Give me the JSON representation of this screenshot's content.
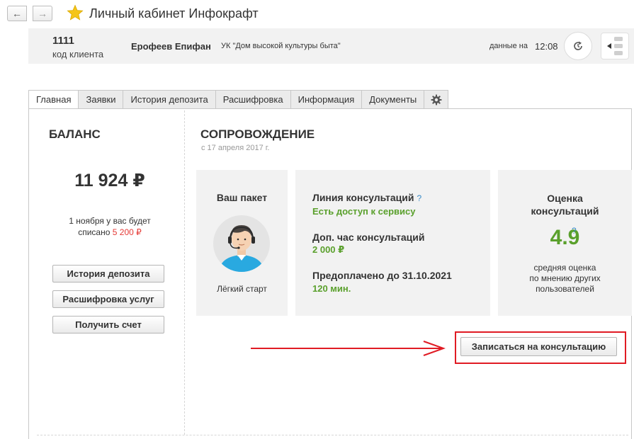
{
  "window": {
    "title": "Личный кабинет Инфокрафт"
  },
  "header": {
    "client_code": "1111",
    "client_code_label": "код клиента",
    "client_name": "Ерофеев Епифан",
    "organization": "УК \"Дом высокой культуры быта\"",
    "data_label": "данные на",
    "data_time": "12:08"
  },
  "tabs": [
    {
      "label": "Главная",
      "active": true
    },
    {
      "label": "Заявки"
    },
    {
      "label": "История депозита"
    },
    {
      "label": "Расшифровка"
    },
    {
      "label": "Информация"
    },
    {
      "label": "Документы"
    }
  ],
  "balance": {
    "title": "БАЛАНС",
    "amount": "11 924 ₽",
    "note_line1": "1 ноября у вас будет",
    "note_line2_prefix": "списано",
    "note_amount": "5 200 ₽",
    "buttons": {
      "history": "История депозита",
      "details": "Расшифровка услуг",
      "invoice": "Получить счет"
    }
  },
  "support": {
    "title": "СОПРОВОЖДЕНИЕ",
    "since": "с 17 апреля 2017 г.",
    "package": {
      "title": "Ваш пакет",
      "name": "Лёгкий старт"
    },
    "consult_line": {
      "label": "Линия консультаций",
      "help": "?",
      "status": "Есть доступ к сервису"
    },
    "extra_hour": {
      "label": "Доп. час консультаций",
      "price": "2 000 ₽"
    },
    "prepaid": {
      "label": "Предоплачено до 31.10.2021",
      "minutes": "120 мин."
    },
    "rating": {
      "title_line1": "Оценка",
      "title_line2": "консультаций",
      "value": "4.9",
      "help": "?",
      "sub_line1": "средняя оценка",
      "sub_line2": "по мнению других",
      "sub_line3": "пользователей"
    },
    "book_button": "Записаться на консультацию"
  },
  "colors": {
    "accent_green": "#5aa02c",
    "accent_red": "#e53935",
    "highlight_red": "#e01b24",
    "help_blue": "#3a8cc8",
    "star_yellow": "#f5c518"
  },
  "icons": {
    "back": "arrow-left-icon",
    "forward": "arrow-right-icon",
    "favorite": "star-icon",
    "refresh": "refresh-icon",
    "side_panel": "panel-toggle-icon",
    "settings": "gear-icon",
    "avatar": "support-operator-avatar"
  }
}
